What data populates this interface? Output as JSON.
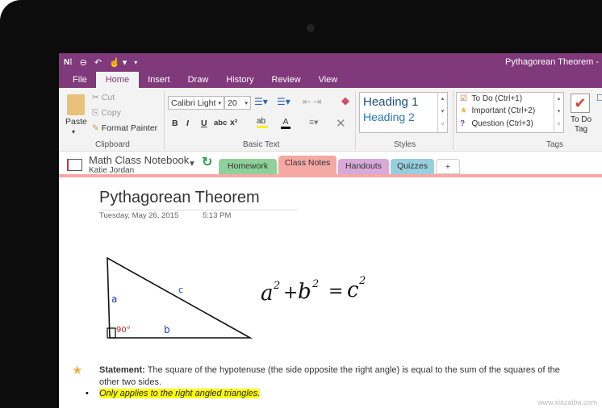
{
  "quick_access": {
    "app": "N",
    "back": "back",
    "undo": "undo",
    "touch": "touch-mode"
  },
  "window_title": "Pythagorean Theorem -",
  "tabs": [
    "File",
    "Home",
    "Insert",
    "Draw",
    "History",
    "Review",
    "View"
  ],
  "clipboard": {
    "paste": "Paste",
    "cut": "Cut",
    "copy": "Copy",
    "format_painter": "Format Painter",
    "label": "Clipboard"
  },
  "basic_text": {
    "font": "Calibri Light",
    "size": "20",
    "bold": "B",
    "italic": "I",
    "underline": "U",
    "strike": "abc",
    "superscript": "x²",
    "label": "Basic Text"
  },
  "styles": {
    "items": [
      "Heading 1",
      "Heading 2"
    ],
    "label": "Styles"
  },
  "tags": {
    "items": [
      "To Do (Ctrl+1)",
      "Important (Ctrl+2)",
      "Question (Ctrl+3)"
    ],
    "todo_tag": "To Do Tag",
    "label": "Tags"
  },
  "notebook": {
    "name": "Math Class Notebook",
    "owner": "Katie Jordan"
  },
  "sections": [
    {
      "label": "Homework",
      "color": "#8fd19a"
    },
    {
      "label": "Class Notes",
      "color": "#f4a9a5"
    },
    {
      "label": "Handouts",
      "color": "#d8a9d9"
    },
    {
      "label": "Quizzes",
      "color": "#97cfdf"
    },
    {
      "label": "+",
      "color": "#ffffff"
    }
  ],
  "page": {
    "title": "Pythagorean Theorem",
    "date": "Tuesday, May 26, 2015",
    "time": "5:13 PM",
    "labels": {
      "a": "a",
      "b": "b",
      "c": "c",
      "angle": "90°"
    },
    "statement_label": "Statement:",
    "statement": " The square of the hypotenuse (the side opposite the right angle) is equal to the sum of the squares of the other two sides.",
    "bullet": "Only applies to the right angled triangles."
  },
  "watermark": "www.xiazaiba.com"
}
